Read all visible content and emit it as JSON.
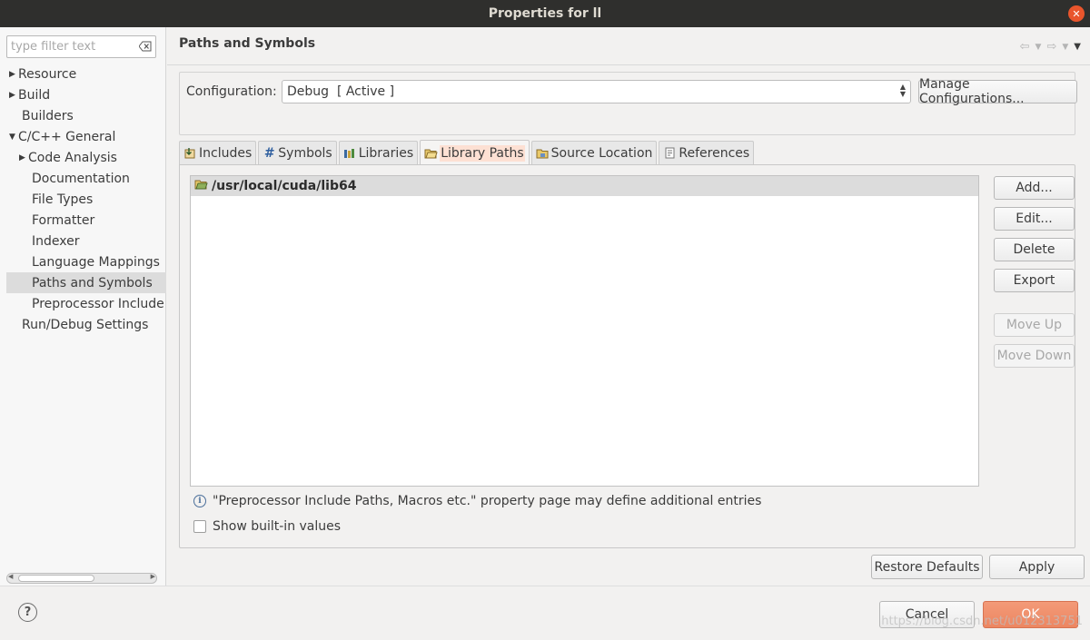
{
  "window": {
    "title": "Properties for ll",
    "close_glyph": "✕"
  },
  "filter": {
    "placeholder": "type filter text"
  },
  "tree": [
    {
      "label": "Resource",
      "level": 0,
      "expandable": true
    },
    {
      "label": "Build",
      "level": 0,
      "expandable": true
    },
    {
      "label": "Builders",
      "level": 0,
      "expandable": false
    },
    {
      "label": "C/C++ General",
      "level": 0,
      "expanded": true
    },
    {
      "label": "Code Analysis",
      "level": 1,
      "expandable": true
    },
    {
      "label": "Documentation",
      "level": 1
    },
    {
      "label": "File Types",
      "level": 1
    },
    {
      "label": "Formatter",
      "level": 1
    },
    {
      "label": "Indexer",
      "level": 1
    },
    {
      "label": "Language Mappings",
      "level": 1
    },
    {
      "label": "Paths and Symbols",
      "level": 1,
      "selected": true
    },
    {
      "label": "Preprocessor Include",
      "level": 1
    },
    {
      "label": "Run/Debug Settings",
      "level": 0
    }
  ],
  "page": {
    "title": "Paths and Symbols"
  },
  "configuration": {
    "label": "Configuration:",
    "value": "Debug  [ Active ]",
    "manage_label": "Manage Configurations..."
  },
  "tabs": [
    {
      "label": "Includes",
      "icon": "includes-icon"
    },
    {
      "label": "Symbols",
      "icon": "hash-icon"
    },
    {
      "label": "Libraries",
      "icon": "libraries-icon"
    },
    {
      "label": "Library Paths",
      "icon": "folder-icon",
      "active": true
    },
    {
      "label": "Source Location",
      "icon": "source-folder-icon"
    },
    {
      "label": "References",
      "icon": "references-icon"
    }
  ],
  "library_paths": [
    "/usr/local/cuda/lib64"
  ],
  "side_buttons": {
    "add": "Add...",
    "edit": "Edit...",
    "delete": "Delete",
    "export": "Export",
    "move_up": "Move Up",
    "move_down": "Move Down"
  },
  "info_text": "\"Preprocessor Include Paths, Macros etc.\" property page may define additional entries",
  "show_builtin_label": "Show built-in values",
  "bottom_buttons": {
    "restore": "Restore Defaults",
    "apply": "Apply"
  },
  "footer": {
    "help": "?",
    "cancel": "Cancel",
    "ok": "OK"
  },
  "watermark": "https://blog.csdn.net/u012313751",
  "colors": {
    "accent": "#ed8661",
    "selected_tab_highlight": "#fde0d3",
    "titlebar": "#2f2f2d"
  }
}
